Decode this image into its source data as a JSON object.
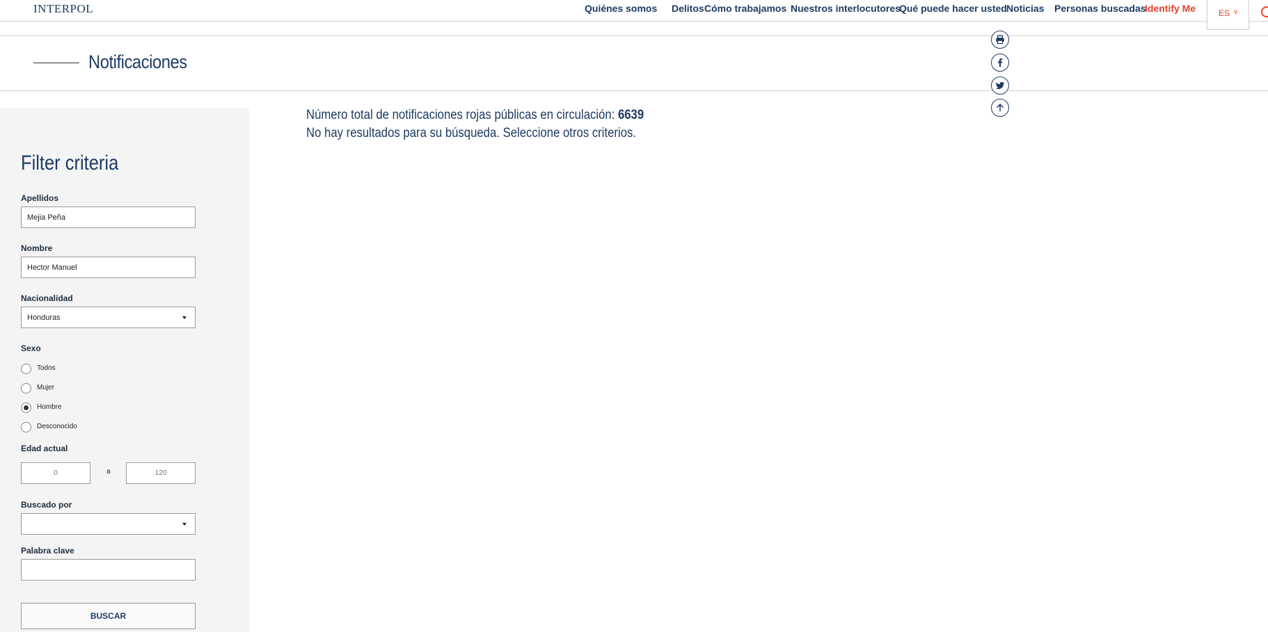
{
  "topbar": {
    "logo": "INTERPOL",
    "nav": [
      {
        "label": "Quiénes somos"
      },
      {
        "label": "Delitos"
      },
      {
        "label": "Cómo trabajamos"
      },
      {
        "label": "Nuestros interlocutores"
      },
      {
        "label": "Qué puede hacer usted"
      },
      {
        "label": "Noticias"
      },
      {
        "label": "Personas buscadas"
      },
      {
        "label": "Identify Me"
      }
    ],
    "language": "ES",
    "language_chevron": "v",
    "accent_color": "#e8412b",
    "brand_color": "#1f3b63"
  },
  "header": {
    "title": "Notificaciones"
  },
  "share_icons": [
    "print-icon",
    "facebook-icon",
    "twitter-icon",
    "arrow-up-icon"
  ],
  "filters": {
    "title": "Filter criteria",
    "surname": {
      "label": "Apellidos",
      "value": "Mejia Peña"
    },
    "forename": {
      "label": "Nombre",
      "value": "Hector Manuel"
    },
    "nationality": {
      "label": "Nacionalidad",
      "value": "Honduras"
    },
    "sex": {
      "label": "Sexo",
      "options": [
        {
          "label": "Todos",
          "checked": false
        },
        {
          "label": "Mujer",
          "checked": false
        },
        {
          "label": "Hombre",
          "checked": true
        },
        {
          "label": "Desconocido",
          "checked": false
        }
      ]
    },
    "age": {
      "label": "Edad actual",
      "min_placeholder": "0",
      "separator": "a",
      "max_placeholder": "120"
    },
    "wanted_by": {
      "label": "Buscado por",
      "value": ""
    },
    "keyword": {
      "label": "Palabra clave",
      "value": ""
    },
    "search_button": "BUSCAR"
  },
  "results": {
    "total_prefix": "Número total de notificaciones rojas públicas en circulación:",
    "total_count": "6639",
    "no_results": "No hay resultados para su búsqueda. Seleccione otros criterios."
  }
}
